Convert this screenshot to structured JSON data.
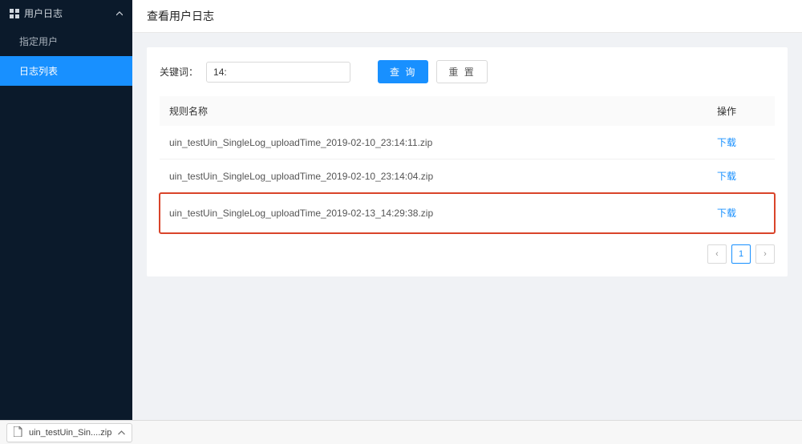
{
  "sidebar": {
    "header_label": "用户日志",
    "items": [
      {
        "label": "指定用户",
        "active": false
      },
      {
        "label": "日志列表",
        "active": true
      }
    ]
  },
  "page": {
    "title": "查看用户日志"
  },
  "filter": {
    "keyword_label": "关键词：",
    "keyword_value": "14:",
    "search_label": "查 询",
    "reset_label": "重 置"
  },
  "table": {
    "columns": {
      "name": "规则名称",
      "action": "操作"
    },
    "action_label": "下载",
    "rows": [
      {
        "name": "uin_testUin_SingleLog_uploadTime_2019-02-10_23:14:11.zip",
        "highlighted": false
      },
      {
        "name": "uin_testUin_SingleLog_uploadTime_2019-02-10_23:14:04.zip",
        "highlighted": false
      },
      {
        "name": "uin_testUin_SingleLog_uploadTime_2019-02-13_14:29:38.zip",
        "highlighted": true
      }
    ]
  },
  "pagination": {
    "prev": "‹",
    "current": "1",
    "next": "›"
  },
  "download_bar": {
    "filename": "uin_testUin_Sin....zip"
  }
}
